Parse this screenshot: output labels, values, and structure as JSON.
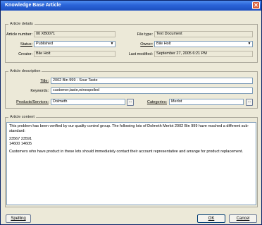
{
  "window": {
    "title": "Knowledge Base Article",
    "close_glyph": "✕"
  },
  "article_details": {
    "legend": "Article details",
    "article_number_label": "Article number:",
    "article_number_value": "00 XB0071",
    "status_label": "Status:",
    "status_value": "Published",
    "creator_label": "Creator:",
    "creator_value": "Bile Holt",
    "file_type_label": "File type:",
    "file_type_value": "Text Document",
    "owner_label": "Owner:",
    "owner_value": "Bile Holt",
    "last_modified_label": "Last modified:",
    "last_modified_value": "September 27, 2005 6:21 PM"
  },
  "article_description": {
    "legend": "Article description",
    "title_label": "Title:",
    "title_value": "2002 Bin 999 - Sour Taste",
    "keywords_label": "Keywords:",
    "keywords_value": "customer,taste,winespoiled",
    "products_label": "Products/Services:",
    "products_value": "Dolmeth",
    "categories_label": "Categories:",
    "categories_value": "Merlot",
    "browse_glyph": "..."
  },
  "article_content": {
    "legend": "Article content",
    "paragraph1": "This problem has been verified by our quality control group. The following lots of Dolmeth Merlot 2002 Bin 999 have reached a different sub-standard:",
    "lots_line1": "23567 23591",
    "lots_line2": "14600 14605",
    "paragraph3": "Customers who have product in these lots should immediately contact their account representative and arrange for product replacement."
  },
  "buttons": {
    "spelling": "Spelling",
    "ok": "OK",
    "cancel": "Cancel"
  },
  "icons": {
    "dropdown": "▼"
  }
}
